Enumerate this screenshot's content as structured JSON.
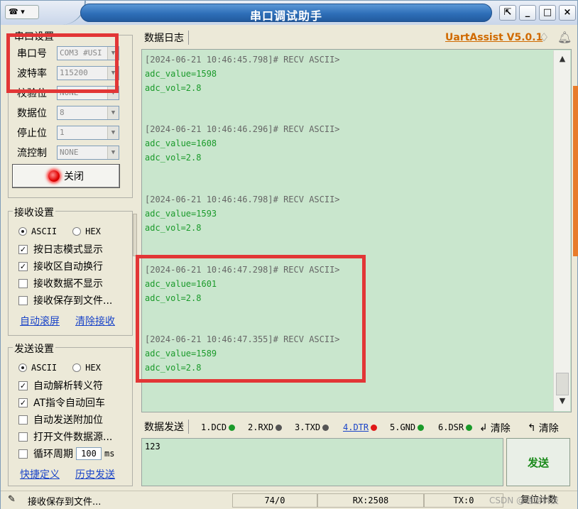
{
  "window": {
    "title": "串口调试助手",
    "sysmenu_label": "☎ ▾",
    "buttons": [
      "⇱",
      "_",
      "□",
      "×"
    ]
  },
  "serial_settings": {
    "title": "串口设置",
    "port_label": "串口号",
    "port_value": "COM3 #USI",
    "baud_label": "波特率",
    "baud_value": "115200",
    "parity_label": "校验位",
    "parity_value": "NONE",
    "databits_label": "数据位",
    "databits_value": "8",
    "stopbits_label": "停止位",
    "stopbits_value": "1",
    "flow_label": "流控制",
    "flow_value": "NONE",
    "close_label": "关闭"
  },
  "recv_settings": {
    "title": "接收设置",
    "ascii": "ASCII",
    "hex": "HEX",
    "opt1": "按日志模式显示",
    "opt2": "接收区自动换行",
    "opt3": "接收数据不显示",
    "opt4": "接收保存到文件...",
    "link_autoscroll": "自动滚屏",
    "link_clear": "清除接收"
  },
  "send_settings": {
    "title": "发送设置",
    "ascii": "ASCII",
    "hex": "HEX",
    "opt1": "自动解析转义符",
    "opt2": "AT指令自动回车",
    "opt3": "自动发送附加位",
    "opt4": "打开文件数据源...",
    "opt5": "循环周期",
    "period_value": "100",
    "period_unit": "ms",
    "link_shortcuts": "快捷定义",
    "link_history": "历史发送"
  },
  "log": {
    "label": "数据日志",
    "brand": "UartAssist V5.0.1",
    "entries": [
      {
        "header": "[2024-06-21 10:46:45.798]# RECV ASCII>",
        "line1": "adc_value=1598",
        "line2": "adc_vol=2.8"
      },
      {
        "header": "[2024-06-21 10:46:46.296]# RECV ASCII>",
        "line1": "adc_value=1608",
        "line2": "adc_vol=2.8"
      },
      {
        "header": "[2024-06-21 10:46:46.798]# RECV ASCII>",
        "line1": "adc_value=1593",
        "line2": "adc_vol=2.8"
      },
      {
        "header": "[2024-06-21 10:46:47.298]# RECV ASCII>",
        "line1": "adc_value=1601",
        "line2": "adc_vol=2.8"
      },
      {
        "header": "[2024-06-21 10:46:47.355]# RECV ASCII>",
        "line1": "adc_value=1589",
        "line2": "adc_vol=2.8"
      }
    ]
  },
  "send": {
    "label": "数据发送",
    "signals": [
      "1.DCD",
      "2.RXD",
      "3.TXD",
      "4.DTR",
      "5.GND",
      "6.DSR"
    ],
    "signal_colors": [
      "#1a9a2a",
      "#444444",
      "#444444",
      "#e01818",
      "#1a9a2a",
      "#1a9a2a"
    ],
    "clear1": "清除",
    "clear2": "清除",
    "input_value": "123",
    "send_button": "发送"
  },
  "status": {
    "left": "接收保存到文件...",
    "count": "74/0",
    "rx": "RX:2508",
    "tx": "TX:0",
    "reset": "复位计数",
    "watermark": "CSDN @通信科技"
  }
}
